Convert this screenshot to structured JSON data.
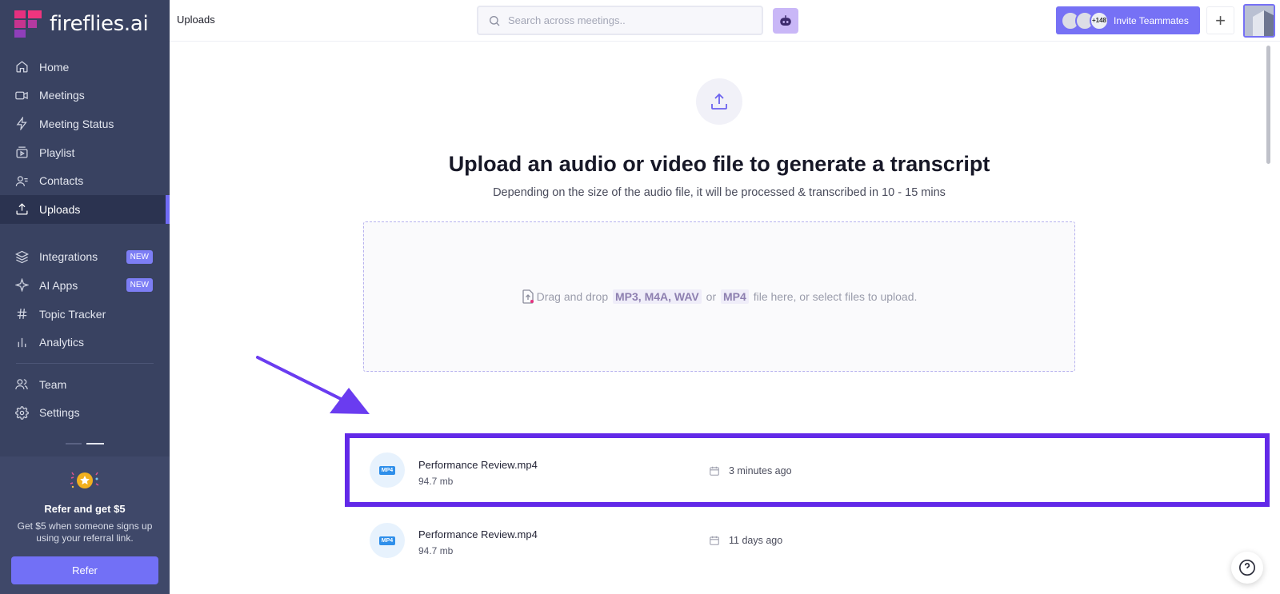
{
  "brand": {
    "name": "fireflies.ai"
  },
  "sidebar": {
    "items": [
      {
        "label": "Home",
        "icon": "home-icon"
      },
      {
        "label": "Meetings",
        "icon": "video-icon"
      },
      {
        "label": "Meeting Status",
        "icon": "bolt-icon"
      },
      {
        "label": "Playlist",
        "icon": "playlist-icon"
      },
      {
        "label": "Contacts",
        "icon": "contacts-icon"
      },
      {
        "label": "Uploads",
        "icon": "upload-icon",
        "active": true
      },
      {
        "label": "Integrations",
        "icon": "layers-icon",
        "badge": "NEW"
      },
      {
        "label": "AI Apps",
        "icon": "sparkle-icon",
        "badge": "NEW"
      },
      {
        "label": "Topic Tracker",
        "icon": "hash-icon"
      },
      {
        "label": "Analytics",
        "icon": "bar-chart-icon"
      },
      {
        "label": "Team",
        "icon": "team-icon"
      },
      {
        "label": "Settings",
        "icon": "gear-icon"
      }
    ],
    "refer": {
      "title": "Refer and get $5",
      "description": "Get $5 when someone signs up using your referral link.",
      "button": "Refer"
    }
  },
  "header": {
    "title": "Uploads",
    "search_placeholder": "Search across meetings..",
    "invite_count": "+148",
    "invite_label": "Invite Teammates",
    "plus_label": "+"
  },
  "main": {
    "heading": "Upload an audio or video file to generate a transcript",
    "subheading": "Depending on the size of the audio file, it will be processed & transcribed in 10 - 15 mins",
    "dropzone": {
      "prefix": "Drag and drop",
      "formats": "MP3, M4A, WAV",
      "or": "or",
      "format_last": "MP4",
      "suffix": "file here, or select files to upload."
    },
    "files": [
      {
        "type": "MP4",
        "name": "Performance Review.mp4",
        "size": "94.7 mb",
        "date": "3 minutes ago",
        "highlighted": true
      },
      {
        "type": "MP4",
        "name": "Performance Review.mp4",
        "size": "94.7 mb",
        "date": "11 days ago",
        "highlighted": false
      }
    ]
  },
  "colors": {
    "sidebar_bg": "#394261",
    "accent": "#7671f5",
    "highlight_border": "#6229e8"
  }
}
